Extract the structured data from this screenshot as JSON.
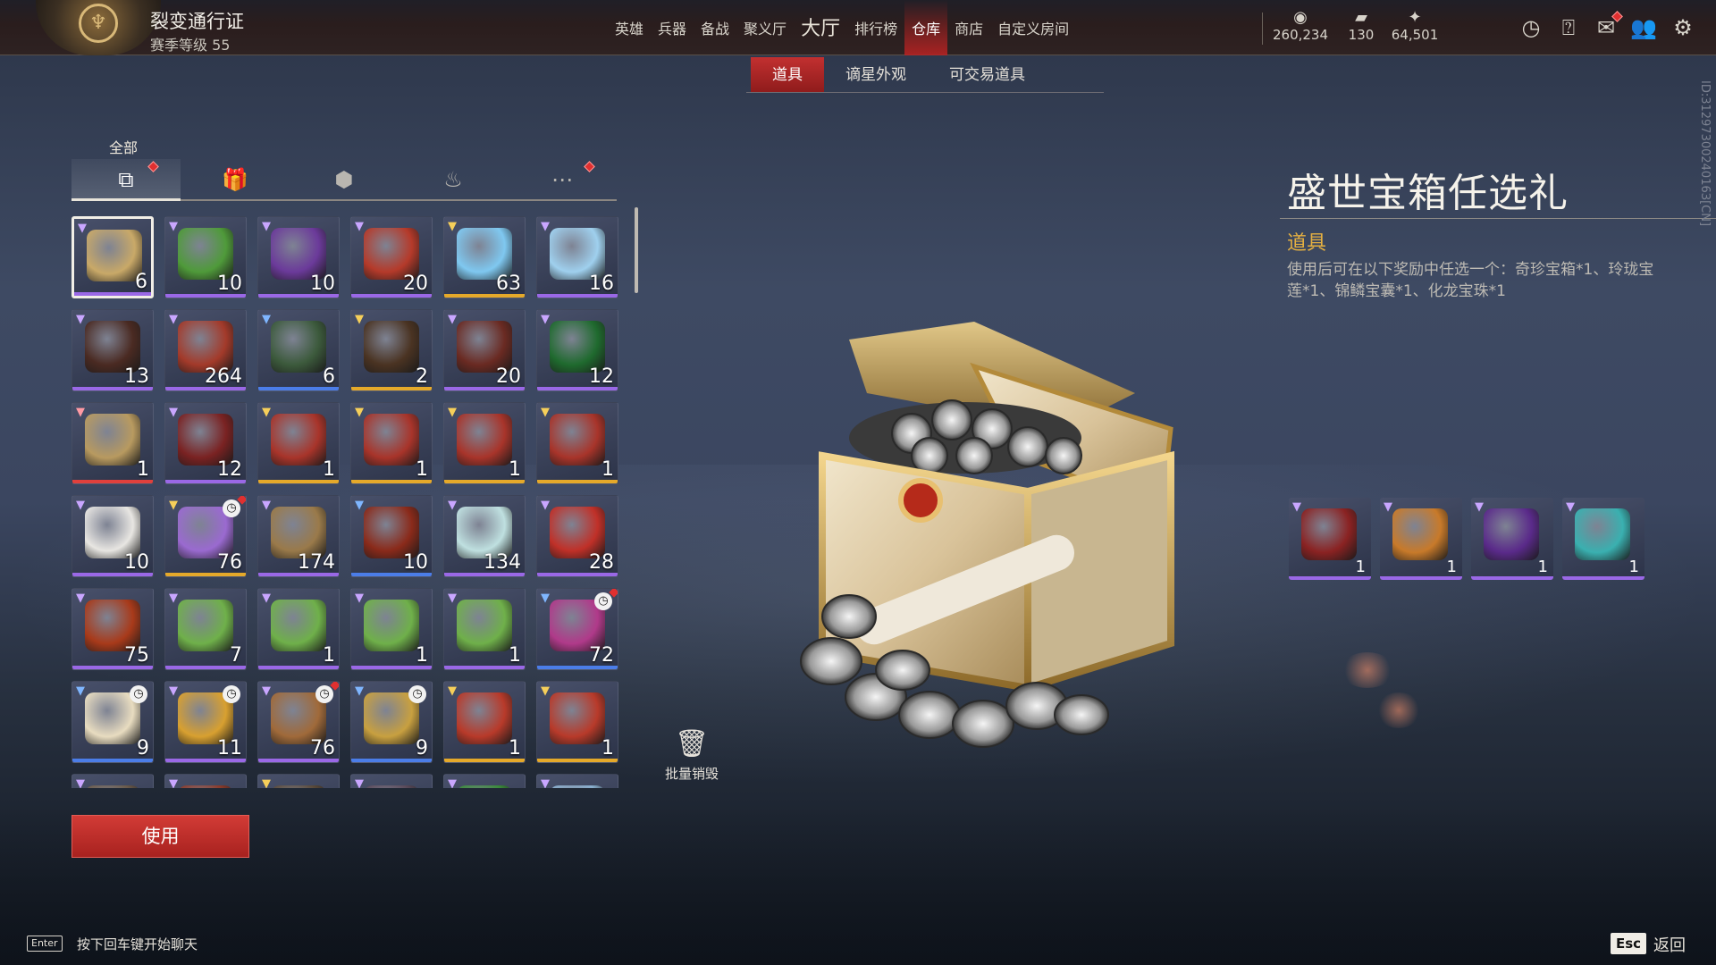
{
  "pass": {
    "title": "裂变通行证",
    "level": "赛季等级 55"
  },
  "nav": [
    {
      "label": "英雄",
      "dot": false
    },
    {
      "label": "兵器",
      "dot": false
    },
    {
      "label": "备战",
      "dot": false
    },
    {
      "label": "聚义厅",
      "dot": true
    },
    {
      "label": "大厅",
      "dot": false,
      "big": true
    },
    {
      "label": "排行榜",
      "dot": false
    },
    {
      "label": "仓库",
      "dot": true,
      "active": true
    },
    {
      "label": "商店",
      "dot": true
    },
    {
      "label": "自定义房间",
      "dot": false
    }
  ],
  "resources": [
    {
      "icon": "coin-icon",
      "glyph": "◉",
      "value": "260,234"
    },
    {
      "icon": "ticket-icon",
      "glyph": "▰",
      "value": "130"
    },
    {
      "icon": "feather-icon",
      "glyph": "✦",
      "value": "64,501"
    }
  ],
  "top_icons": [
    "clock-icon",
    "help-icon",
    "mail-icon",
    "friends-icon",
    "settings-icon"
  ],
  "subtabs": [
    {
      "label": "道具",
      "active": true,
      "dot": true
    },
    {
      "label": "谪星外观",
      "active": false
    },
    {
      "label": "可交易道具",
      "active": false
    }
  ],
  "category": {
    "active_label": "全部",
    "tabs": [
      "layers-icon",
      "gift-icon",
      "badge-icon",
      "flame-icon",
      "more-icon"
    ]
  },
  "items": [
    {
      "count": "6",
      "q": "purple",
      "color": "#c9a968",
      "sel": true
    },
    {
      "count": "10",
      "q": "purple",
      "color": "#4f9a3a"
    },
    {
      "count": "10",
      "q": "purple",
      "color": "#6b3a9a"
    },
    {
      "count": "20",
      "q": "purple",
      "color": "#b53a2a"
    },
    {
      "count": "63",
      "q": "gold",
      "color": "#7fc8f0"
    },
    {
      "count": "16",
      "q": "purple",
      "color": "#9fd0ee"
    },
    {
      "count": "13",
      "q": "purple",
      "color": "#4a2a22"
    },
    {
      "count": "264",
      "q": "purple",
      "color": "#a33a2a"
    },
    {
      "count": "6",
      "q": "blue",
      "color": "#3c5a3c"
    },
    {
      "count": "2",
      "q": "gold",
      "color": "#4a3322"
    },
    {
      "count": "20",
      "q": "purple",
      "color": "#6a2a22"
    },
    {
      "count": "12",
      "q": "purple",
      "color": "#1f6a2e"
    },
    {
      "count": "1",
      "q": "red",
      "color": "#b89a60"
    },
    {
      "count": "12",
      "q": "purple",
      "color": "#7a2222"
    },
    {
      "count": "1",
      "q": "gold",
      "color": "#a8342a"
    },
    {
      "count": "1",
      "q": "gold",
      "color": "#a8342a"
    },
    {
      "count": "1",
      "q": "gold",
      "color": "#a8342a"
    },
    {
      "count": "1",
      "q": "gold",
      "color": "#a8342a"
    },
    {
      "count": "10",
      "q": "purple",
      "color": "#e8e6e2"
    },
    {
      "count": "76",
      "q": "gold",
      "color": "#9a6ad0",
      "clock": true,
      "dot": true
    },
    {
      "count": "174",
      "q": "purple",
      "color": "#9a7a4a"
    },
    {
      "count": "10",
      "q": "blue",
      "color": "#8a2a1a"
    },
    {
      "count": "134",
      "q": "purple",
      "color": "#bfe0e0"
    },
    {
      "count": "28",
      "q": "purple",
      "color": "#c03028"
    },
    {
      "count": "75",
      "q": "purple",
      "color": "#a83a1a"
    },
    {
      "count": "7",
      "q": "purple",
      "color": "#6fb04a"
    },
    {
      "count": "1",
      "q": "purple",
      "color": "#6fb04a"
    },
    {
      "count": "1",
      "q": "purple",
      "color": "#6fb04a"
    },
    {
      "count": "1",
      "q": "purple",
      "color": "#6fb04a"
    },
    {
      "count": "72",
      "q": "blue",
      "color": "#b03a8a",
      "clock": true,
      "dot": true
    },
    {
      "count": "9",
      "q": "blue",
      "color": "#e8dcc0",
      "clock": true
    },
    {
      "count": "11",
      "q": "purple",
      "color": "#d8a030",
      "clock": true
    },
    {
      "count": "76",
      "q": "purple",
      "color": "#a06a3a",
      "clock": true,
      "dot": true
    },
    {
      "count": "9",
      "q": "blue",
      "color": "#c8a040",
      "clock": true
    },
    {
      "count": "1",
      "q": "gold",
      "color": "#b83a2a"
    },
    {
      "count": "1",
      "q": "gold",
      "color": "#b83a2a"
    },
    {
      "count": "",
      "q": "purple",
      "color": "#6a5a4a"
    },
    {
      "count": "",
      "q": "purple",
      "color": "#8a3a2a"
    },
    {
      "count": "",
      "q": "gold",
      "color": "#5a4a3a"
    },
    {
      "count": "",
      "q": "purple",
      "color": "#5a4a5a"
    },
    {
      "count": "",
      "q": "purple",
      "color": "#3a8a3a"
    },
    {
      "count": "",
      "q": "purple",
      "color": "#8ab0d0"
    }
  ],
  "actions": {
    "destroy_label": "批量销毁",
    "use_label": "使用"
  },
  "detail": {
    "title": "盛世宝箱任选礼",
    "type": "道具",
    "desc": "使用后可在以下奖励中任选一个：奇珍宝箱*1、玲珑宝莲*1、锦鳞宝囊*1、化龙宝珠*1",
    "id_text": "ID:3129730024016З[CN]"
  },
  "rewards": [
    {
      "count": "1",
      "color": "#8a2222"
    },
    {
      "count": "1",
      "color": "#c87a2a"
    },
    {
      "count": "1",
      "color": "#5a2a8a"
    },
    {
      "count": "1",
      "color": "#3ab0b0"
    }
  ],
  "footer": {
    "enter_key": "Enter",
    "chat_hint": "按下回车键开始聊天",
    "esc_key": "Esc",
    "back": "返回"
  }
}
